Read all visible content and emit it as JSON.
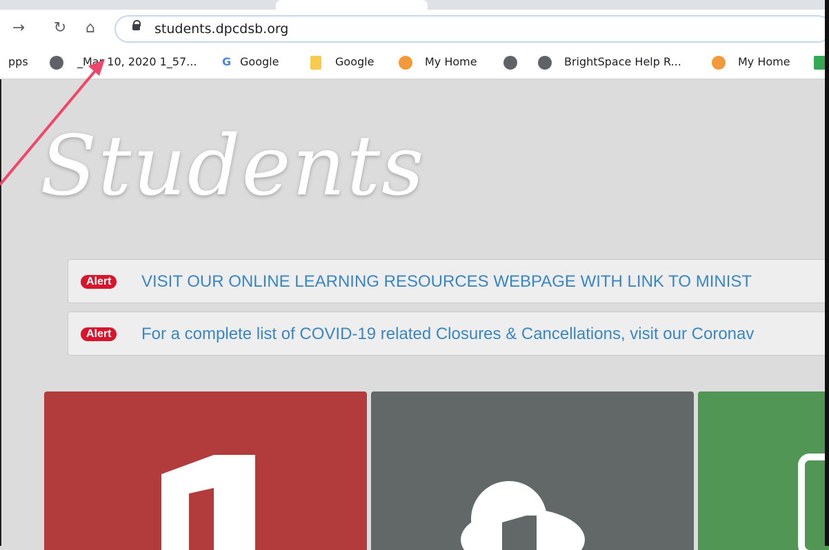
{
  "browser": {
    "url": "students.dpcdsb.org",
    "bookmarks": [
      "pps",
      "_Mar 10, 2020 1_57...",
      "Google",
      "Google",
      "My Home",
      "BrightSpace Help R...",
      "My Home"
    ]
  },
  "page": {
    "heading": "Students",
    "alerts": [
      {
        "badge": "Alert",
        "text": "VISIT OUR ONLINE LEARNING RESOURCES WEBPAGE WITH LINK TO MINIST"
      },
      {
        "badge": "Alert",
        "text": "For a complete list of COVID-19 related Closures & Cancellations, visit our Coronav"
      }
    ],
    "tiles": [
      {
        "color": "#b23b3b",
        "icon": "office-icon"
      },
      {
        "color": "#616867",
        "icon": "onedrive-office-icon"
      },
      {
        "color": "#519654",
        "icon": "phone-icon"
      }
    ]
  },
  "annotation": {
    "arrow_color": "#f0466a"
  }
}
